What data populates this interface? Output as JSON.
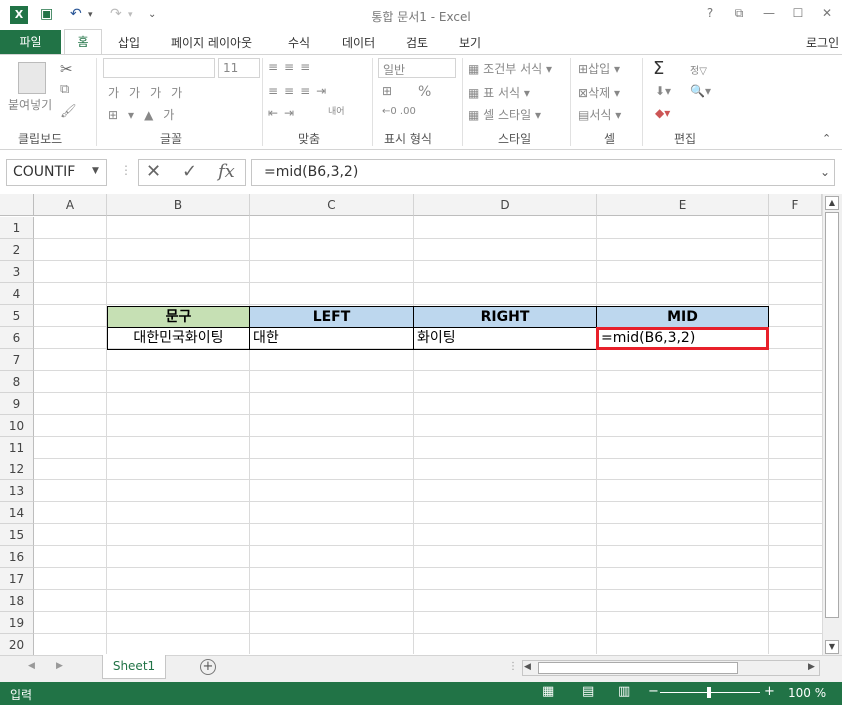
{
  "app": {
    "title": "통합 문서1 - Excel",
    "signin": "로그인"
  },
  "tabs": {
    "file": "파일",
    "home": "홈",
    "insert": "삽입",
    "layout": "페이지 레이아웃",
    "formulas": "수식",
    "data": "데이터",
    "review": "검토",
    "view": "보기"
  },
  "ribbon": {
    "paste": "붙여넣기",
    "clipboard": "클립보드",
    "font_name": "",
    "font_size": "11",
    "font": "글꼴",
    "align": "맞춤",
    "wrap": "내어",
    "numfmt_value": "일반",
    "number": "표시 형식",
    "percent": "%",
    "cond": "조건부 서식",
    "table": "표 서식",
    "cellstyle": "셀 스타일",
    "styles": "스타일",
    "insert": "삽입",
    "delete": "삭제",
    "format": "서식",
    "cells": "셀",
    "edit": "편집",
    "sigma": "Σ",
    "sort": "정▽"
  },
  "formula_bar": {
    "name_box": "COUNTIF",
    "fx": "fx",
    "formula": "=mid(B6,3,2)"
  },
  "columns": [
    "A",
    "B",
    "C",
    "D",
    "E",
    "F"
  ],
  "rows": [
    "1",
    "2",
    "3",
    "4",
    "5",
    "6",
    "7",
    "8",
    "9",
    "10",
    "11",
    "12",
    "13",
    "14",
    "15",
    "16",
    "17",
    "18",
    "19",
    "20"
  ],
  "table": {
    "headers": [
      "문구",
      "LEFT",
      "RIGHT",
      "MID"
    ],
    "row6": [
      "대한민국화이팅",
      "대한",
      "화이팅",
      "=mid(B6,3,2)"
    ]
  },
  "sheet_tab": "Sheet1",
  "status": {
    "mode": "입력",
    "zoom": "100 %"
  },
  "colors": {
    "accent": "#217346",
    "header_green": "#c6e0b4",
    "header_blue": "#bdd7ee",
    "highlight": "#e8202a"
  }
}
